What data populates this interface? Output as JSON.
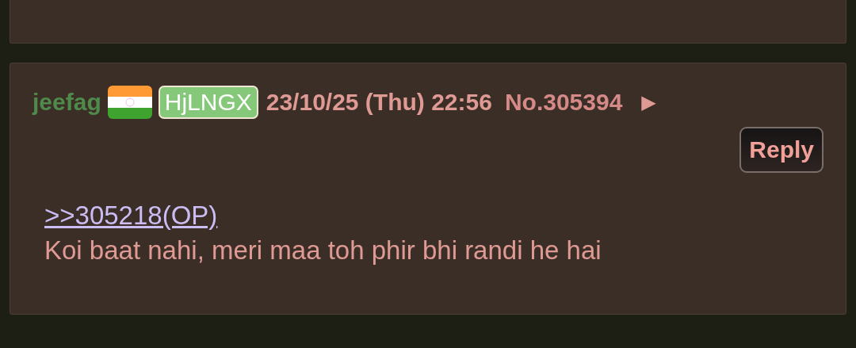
{
  "post": {
    "name": "jeefag",
    "id": "HjLNGX",
    "date": "23/10/25 (Thu) 22:56",
    "number": "No.305394",
    "menu": "▶",
    "reply_button": "Reply",
    "quote": ">>305218(OP)",
    "message": "Koi baat nahi, meri maa toh phir bhi randi he hai"
  }
}
